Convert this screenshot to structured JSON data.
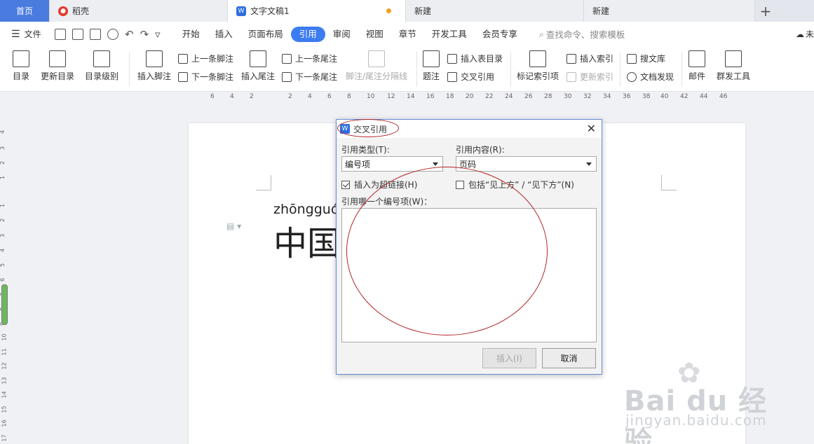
{
  "tabs": [
    {
      "label": "首页"
    },
    {
      "label": "稻壳"
    },
    {
      "label": "文字文稿1"
    },
    {
      "label": "新建"
    },
    {
      "label": "新建"
    }
  ],
  "menubar": {
    "file": "文件",
    "menus": [
      "开始",
      "插入",
      "页面布局",
      "引用",
      "审阅",
      "视图",
      "章节",
      "开发工具",
      "会员专享"
    ],
    "active": "引用",
    "search": "查找命令、搜索模板",
    "cloud": "未"
  },
  "ribbon": {
    "toc": "目录",
    "update_toc": "更新目录",
    "toc_level": "目录级别",
    "insert_footnote": "插入脚注",
    "prev_footnote": "上一条脚注",
    "next_footnote": "下一条脚注",
    "insert_endnote": "插入尾注",
    "prev_endnote": "上一条尾注",
    "next_endnote": "下一条尾注",
    "separator_line": "脚注/尾注分隔线",
    "caption": "题注",
    "insert_table_toc": "插入表目录",
    "cross_ref": "交叉引用",
    "mark_index": "标记索引项",
    "insert_index": "插入索引",
    "update_index": "更新索引",
    "search_lib": "搜文库",
    "doc_discover": "文档发现",
    "mail": "邮件",
    "mass_tools": "群发工具"
  },
  "ruler": {
    "h_ticks": [
      "6",
      "4",
      "2",
      "2",
      "4",
      "6",
      "8",
      "10",
      "12",
      "14",
      "16",
      "18",
      "20",
      "22",
      "24",
      "26",
      "28",
      "30",
      "32",
      "34",
      "36",
      "38",
      "40",
      "42",
      "44",
      "46"
    ],
    "v_ticks": [
      "4",
      "3",
      "2",
      "1",
      "1",
      "2",
      "3",
      "4",
      "5",
      "6",
      "7",
      "8",
      "9",
      "10",
      "11",
      "12",
      "13",
      "14",
      "15",
      "16",
      "17"
    ]
  },
  "document": {
    "pinyin": "zhōngguó",
    "hanzi": "中国"
  },
  "dialog": {
    "title": "交叉引用",
    "ref_type_label": "引用类型(T):",
    "ref_type_value": "编号项",
    "ref_content_label": "引用内容(R):",
    "ref_content_value": "页码",
    "hyperlink_label": "插入为超链接(H)",
    "hyperlink_checked": true,
    "above_below_label": "包括“见上方” / “见下方”(N)",
    "above_below_checked": false,
    "which_item_label": "引用哪一个编号项(W)：",
    "insert_button": "插入(I)",
    "cancel_button": "取消"
  },
  "watermark": {
    "main": "Bai du 经验",
    "url": "jingyan.baidu.com"
  },
  "colors": {
    "accent": "#3d7bf0",
    "home_tab": "#4a7ce0",
    "annotation": "#b52323"
  }
}
